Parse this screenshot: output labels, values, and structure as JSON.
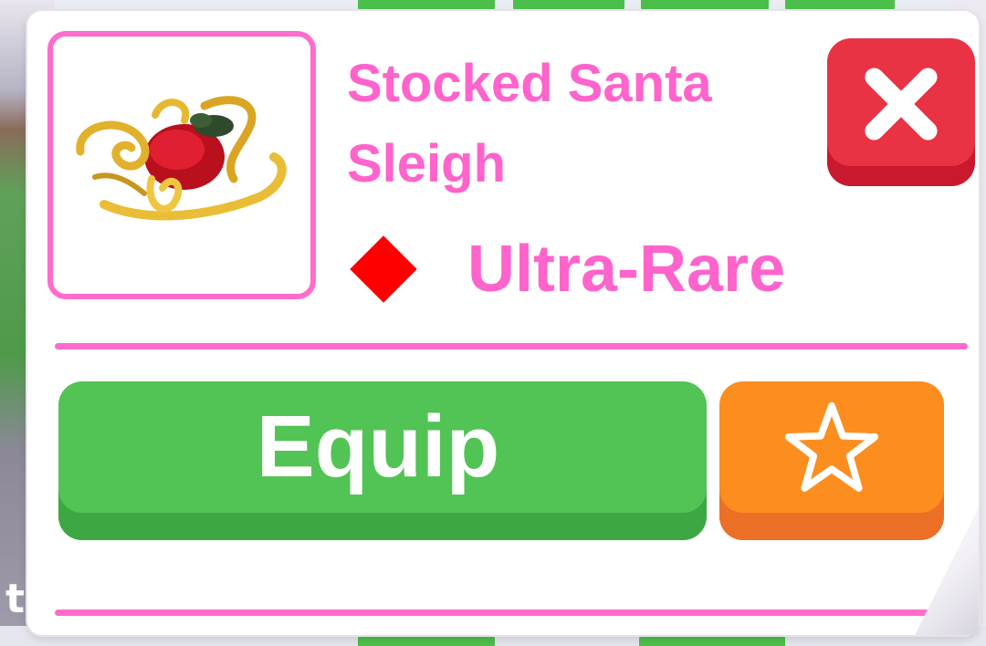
{
  "item": {
    "name": "Stocked Santa Sleigh",
    "rarity": "Ultra-Rare",
    "rarity_color": "#ff0000",
    "image_icon": "sleigh-icon"
  },
  "actions": {
    "equip_label": "Equip",
    "favorite_icon": "star-outline-icon",
    "close_icon": "close-icon"
  },
  "theme": {
    "accent_pink": "#ff63cc",
    "equip_green": "#52c355",
    "favorite_orange": "#fb8e1e",
    "close_red": "#e93344"
  }
}
